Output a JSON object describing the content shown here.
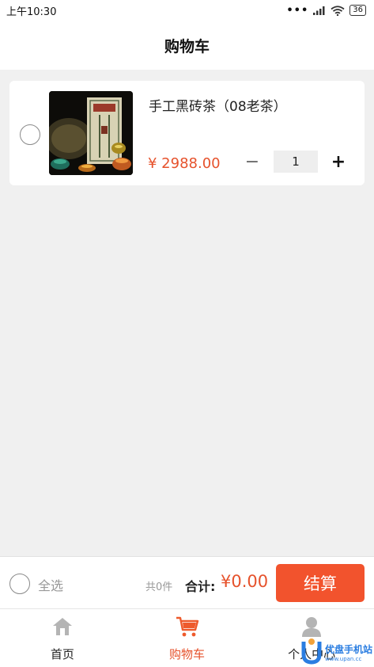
{
  "status_bar": {
    "time": "上午10:30",
    "battery": "36"
  },
  "header": {
    "title": "购物车"
  },
  "cart": {
    "items": [
      {
        "title": "手工黑砖茶（08老茶）",
        "price": "¥ 2988.00",
        "quantity": "1",
        "minus_label": "−",
        "plus_label": "+"
      }
    ]
  },
  "checkout": {
    "select_all_label": "全选",
    "count_text": "共0件",
    "total_label": "合计:",
    "total_value": "¥0.00",
    "checkout_button": "结算"
  },
  "tabbar": {
    "tabs": [
      {
        "label": "首页",
        "icon": "home-icon"
      },
      {
        "label": "购物车",
        "icon": "cart-icon"
      },
      {
        "label": "个人中心",
        "icon": "user-icon"
      }
    ],
    "active_index": 1
  },
  "watermark": {
    "text": "优盘手机站",
    "sub": "www.upan.cc"
  },
  "colors": {
    "accent": "#f2532d",
    "price": "#e6522c",
    "background": "#f0f0f0"
  }
}
